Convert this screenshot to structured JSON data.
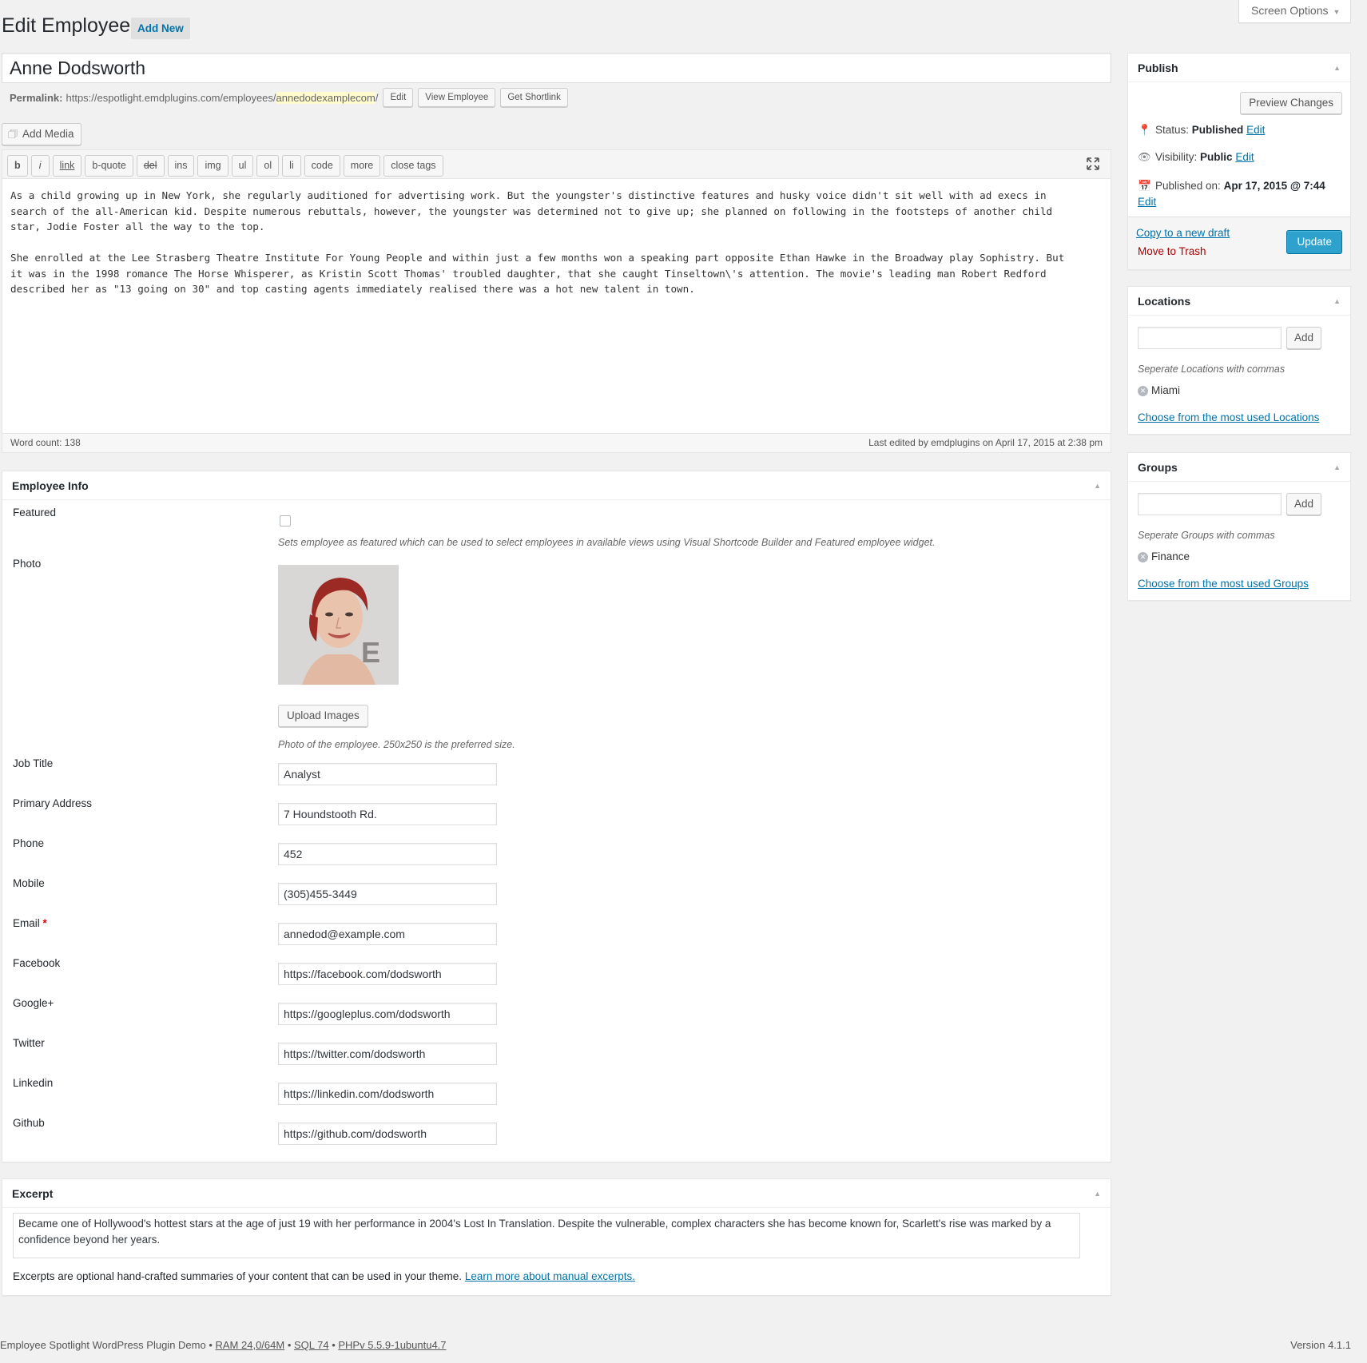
{
  "header": {
    "title": "Edit Employee",
    "add_new": "Add New",
    "screen_options": "Screen Options"
  },
  "post": {
    "title": "Anne Dodsworth",
    "permalink_label": "Permalink:",
    "permalink_base": "https://espotlight.emdplugins.com/employees/",
    "permalink_slug": "annedodexamplecom",
    "permalink_trail": "/",
    "edit_btn": "Edit",
    "view_btn": "View Employee",
    "shortlink_btn": "Get Shortlink"
  },
  "editor": {
    "add_media": "Add Media",
    "toolbar": [
      "b",
      "i",
      "link",
      "b-quote",
      "del",
      "ins",
      "img",
      "ul",
      "ol",
      "li",
      "code",
      "more",
      "close tags"
    ],
    "content": "As a child growing up in New York, she regularly auditioned for advertising work. But the youngster's distinctive features and husky voice didn't sit well with ad execs in\nsearch of the all-American kid. Despite numerous rebuttals, however, the youngster was determined not to give up; she planned on following in the footsteps of another child\nstar, Jodie Foster all the way to the top.\n\nShe enrolled at the Lee Strasberg Theatre Institute For Young People and within just a few months won a speaking part opposite Ethan Hawke in the Broadway play Sophistry. But\nit was in the 1998 romance The Horse Whisperer, as Kristin Scott Thomas' troubled daughter, that she caught Tinseltown\\'s attention. The movie's leading man Robert Redford\ndescribed her as \"13 going on 30\" and top casting agents immediately realised there was a hot new talent in town.",
    "word_count": "Word count: 138",
    "last_edited": "Last edited by emdplugins on April 17, 2015 at 2:38 pm"
  },
  "employee_info": {
    "heading": "Employee Info",
    "featured_label": "Featured",
    "featured_desc": "Sets employee as featured which can be used to select employees in available views using Visual Shortcode Builder and Featured employee widget.",
    "photo_label": "Photo",
    "upload_btn": "Upload Images",
    "photo_desc": "Photo of the employee. 250x250 is the preferred size.",
    "fields": [
      {
        "label": "Job Title",
        "value": "Analyst"
      },
      {
        "label": "Primary Address",
        "value": "7 Houndstooth Rd."
      },
      {
        "label": "Phone",
        "value": "452"
      },
      {
        "label": "Mobile",
        "value": "(305)455-3449"
      },
      {
        "label": "Email",
        "value": "annedod@example.com",
        "required": "*"
      },
      {
        "label": "Facebook",
        "value": "https://facebook.com/dodsworth"
      },
      {
        "label": "Google+",
        "value": "https://googleplus.com/dodsworth"
      },
      {
        "label": "Twitter",
        "value": "https://twitter.com/dodsworth"
      },
      {
        "label": "Linkedin",
        "value": "https://linkedin.com/dodsworth"
      },
      {
        "label": "Github",
        "value": "https://github.com/dodsworth"
      }
    ]
  },
  "excerpt": {
    "heading": "Excerpt",
    "value": "Became one of Hollywood's hottest stars at the age of just 19 with her performance in 2004's Lost In Translation. Despite the vulnerable, complex characters she has become known for, Scarlett's rise was marked by a confidence beyond her years.",
    "note": "Excerpts are optional hand-crafted summaries of your content that can be used in your theme.",
    "note_link": "Learn more about manual excerpts."
  },
  "publish": {
    "heading": "Publish",
    "preview": "Preview Changes",
    "status_label": "Status:",
    "status_value": "Published",
    "visibility_label": "Visibility:",
    "visibility_value": "Public",
    "published_label": "Published on:",
    "published_value": "Apr 17, 2015 @ 7:44",
    "edit": "Edit",
    "copy_draft": "Copy to a new draft",
    "trash": "Move to Trash",
    "update": "Update"
  },
  "locations": {
    "heading": "Locations",
    "add": "Add",
    "hint": "Seperate Locations with commas",
    "tag": "Miami",
    "link": "Choose from the most used Locations"
  },
  "groups": {
    "heading": "Groups",
    "add": "Add",
    "hint": "Seperate Groups with commas",
    "tag": "Finance",
    "link": "Choose from the most used Groups"
  },
  "footer": {
    "site": "Employee Spotlight WordPress Plugin Demo",
    "ram": "RAM 24,0/64M",
    "sql": "SQL 74",
    "php": "PHPv 5.5.9-1ubuntu4.7",
    "sep": " • ",
    "version": "Version 4.1.1"
  },
  "colors": {
    "accent": "#0073aa",
    "update_button": "#2ea2cc",
    "trash": "#a00",
    "background": "#f1f1f1"
  }
}
